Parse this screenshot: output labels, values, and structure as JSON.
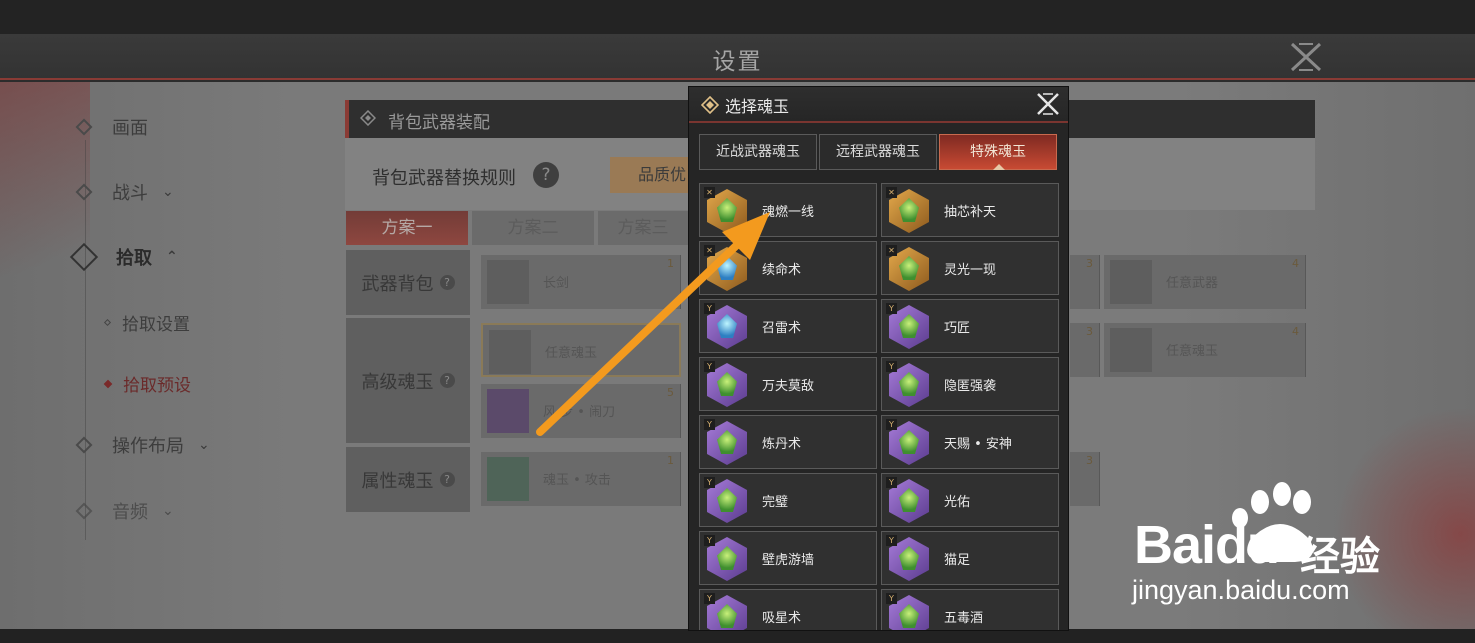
{
  "settings": {
    "title": "设置"
  },
  "sidebar": {
    "items": [
      {
        "label": "画面",
        "chevron": ""
      },
      {
        "label": "战斗",
        "chevron": "⌄"
      },
      {
        "label": "拾取",
        "chevron": "⌃"
      },
      {
        "label": "操作布局",
        "chevron": "⌄"
      },
      {
        "label": "音频",
        "chevron": "⌄"
      }
    ],
    "sub_items": [
      {
        "label": "拾取设置"
      },
      {
        "label": "拾取预设"
      }
    ]
  },
  "panel": {
    "header": "背包武器装配",
    "rule_label": "背包武器替换规则",
    "help": "?",
    "rule_button": "品质优",
    "plan_tabs": [
      "方案一",
      "方案二",
      "方案三"
    ],
    "rows": [
      {
        "label": "武器背包",
        "help": "?"
      },
      {
        "label": "高级魂玉",
        "help": "?"
      },
      {
        "label": "属性魂玉",
        "help": "?"
      }
    ],
    "slots": [
      {
        "label": "长剑",
        "num": "1"
      },
      {
        "label": "",
        "num": "3"
      },
      {
        "label": "任意武器",
        "num": "4"
      },
      {
        "label": "任意魂玉",
        "num": ""
      },
      {
        "label": "",
        "num": "3"
      },
      {
        "label": "任意魂玉",
        "num": "4"
      },
      {
        "label": "风 步 • 闹刀",
        "num": "5"
      },
      {
        "label": "魂玉 • 攻击",
        "num": "1"
      },
      {
        "label": "",
        "num": "3"
      }
    ]
  },
  "modal": {
    "title": "选择魂玉",
    "tabs": [
      {
        "label": "近战武器魂玉"
      },
      {
        "label": "远程武器魂玉"
      },
      {
        "label": "特殊魂玉"
      }
    ],
    "active_tab": 2,
    "cards": [
      {
        "name": "魂燃一线",
        "frame": "gold",
        "gem": "green"
      },
      {
        "name": "抽芯补天",
        "frame": "gold",
        "gem": "green"
      },
      {
        "name": "续命术",
        "frame": "gold",
        "gem": "blue"
      },
      {
        "name": "灵光一现",
        "frame": "gold",
        "gem": "green"
      },
      {
        "name": "召雷术",
        "frame": "purple",
        "gem": "blue"
      },
      {
        "name": "巧匠",
        "frame": "purple",
        "gem": "green"
      },
      {
        "name": "万夫莫敌",
        "frame": "purple",
        "gem": "green"
      },
      {
        "name": "隐匿强袭",
        "frame": "purple",
        "gem": "green"
      },
      {
        "name": "炼丹术",
        "frame": "purple",
        "gem": "green"
      },
      {
        "name": "天赐 • 安神",
        "frame": "purple",
        "gem": "green"
      },
      {
        "name": "完璧",
        "frame": "purple",
        "gem": "green"
      },
      {
        "name": "光佑",
        "frame": "purple",
        "gem": "green"
      },
      {
        "name": "壁虎游墙",
        "frame": "purple",
        "gem": "green"
      },
      {
        "name": "猫足",
        "frame": "purple",
        "gem": "green"
      },
      {
        "name": "吸星术",
        "frame": "purple",
        "gem": "green"
      },
      {
        "name": "五毒酒",
        "frame": "purple",
        "gem": "green"
      }
    ]
  },
  "annotation": {
    "arrow_color": "#f39a1e"
  },
  "watermark": {
    "brand": "Baidu",
    "brand_cn": "经验",
    "url": "jingyan.baidu.com"
  },
  "colors": {
    "accent_red": "#8a3b35",
    "tab_active": "#c84a33",
    "rare_gold": "#e3a94b",
    "epic_purple": "#a67bd8"
  }
}
